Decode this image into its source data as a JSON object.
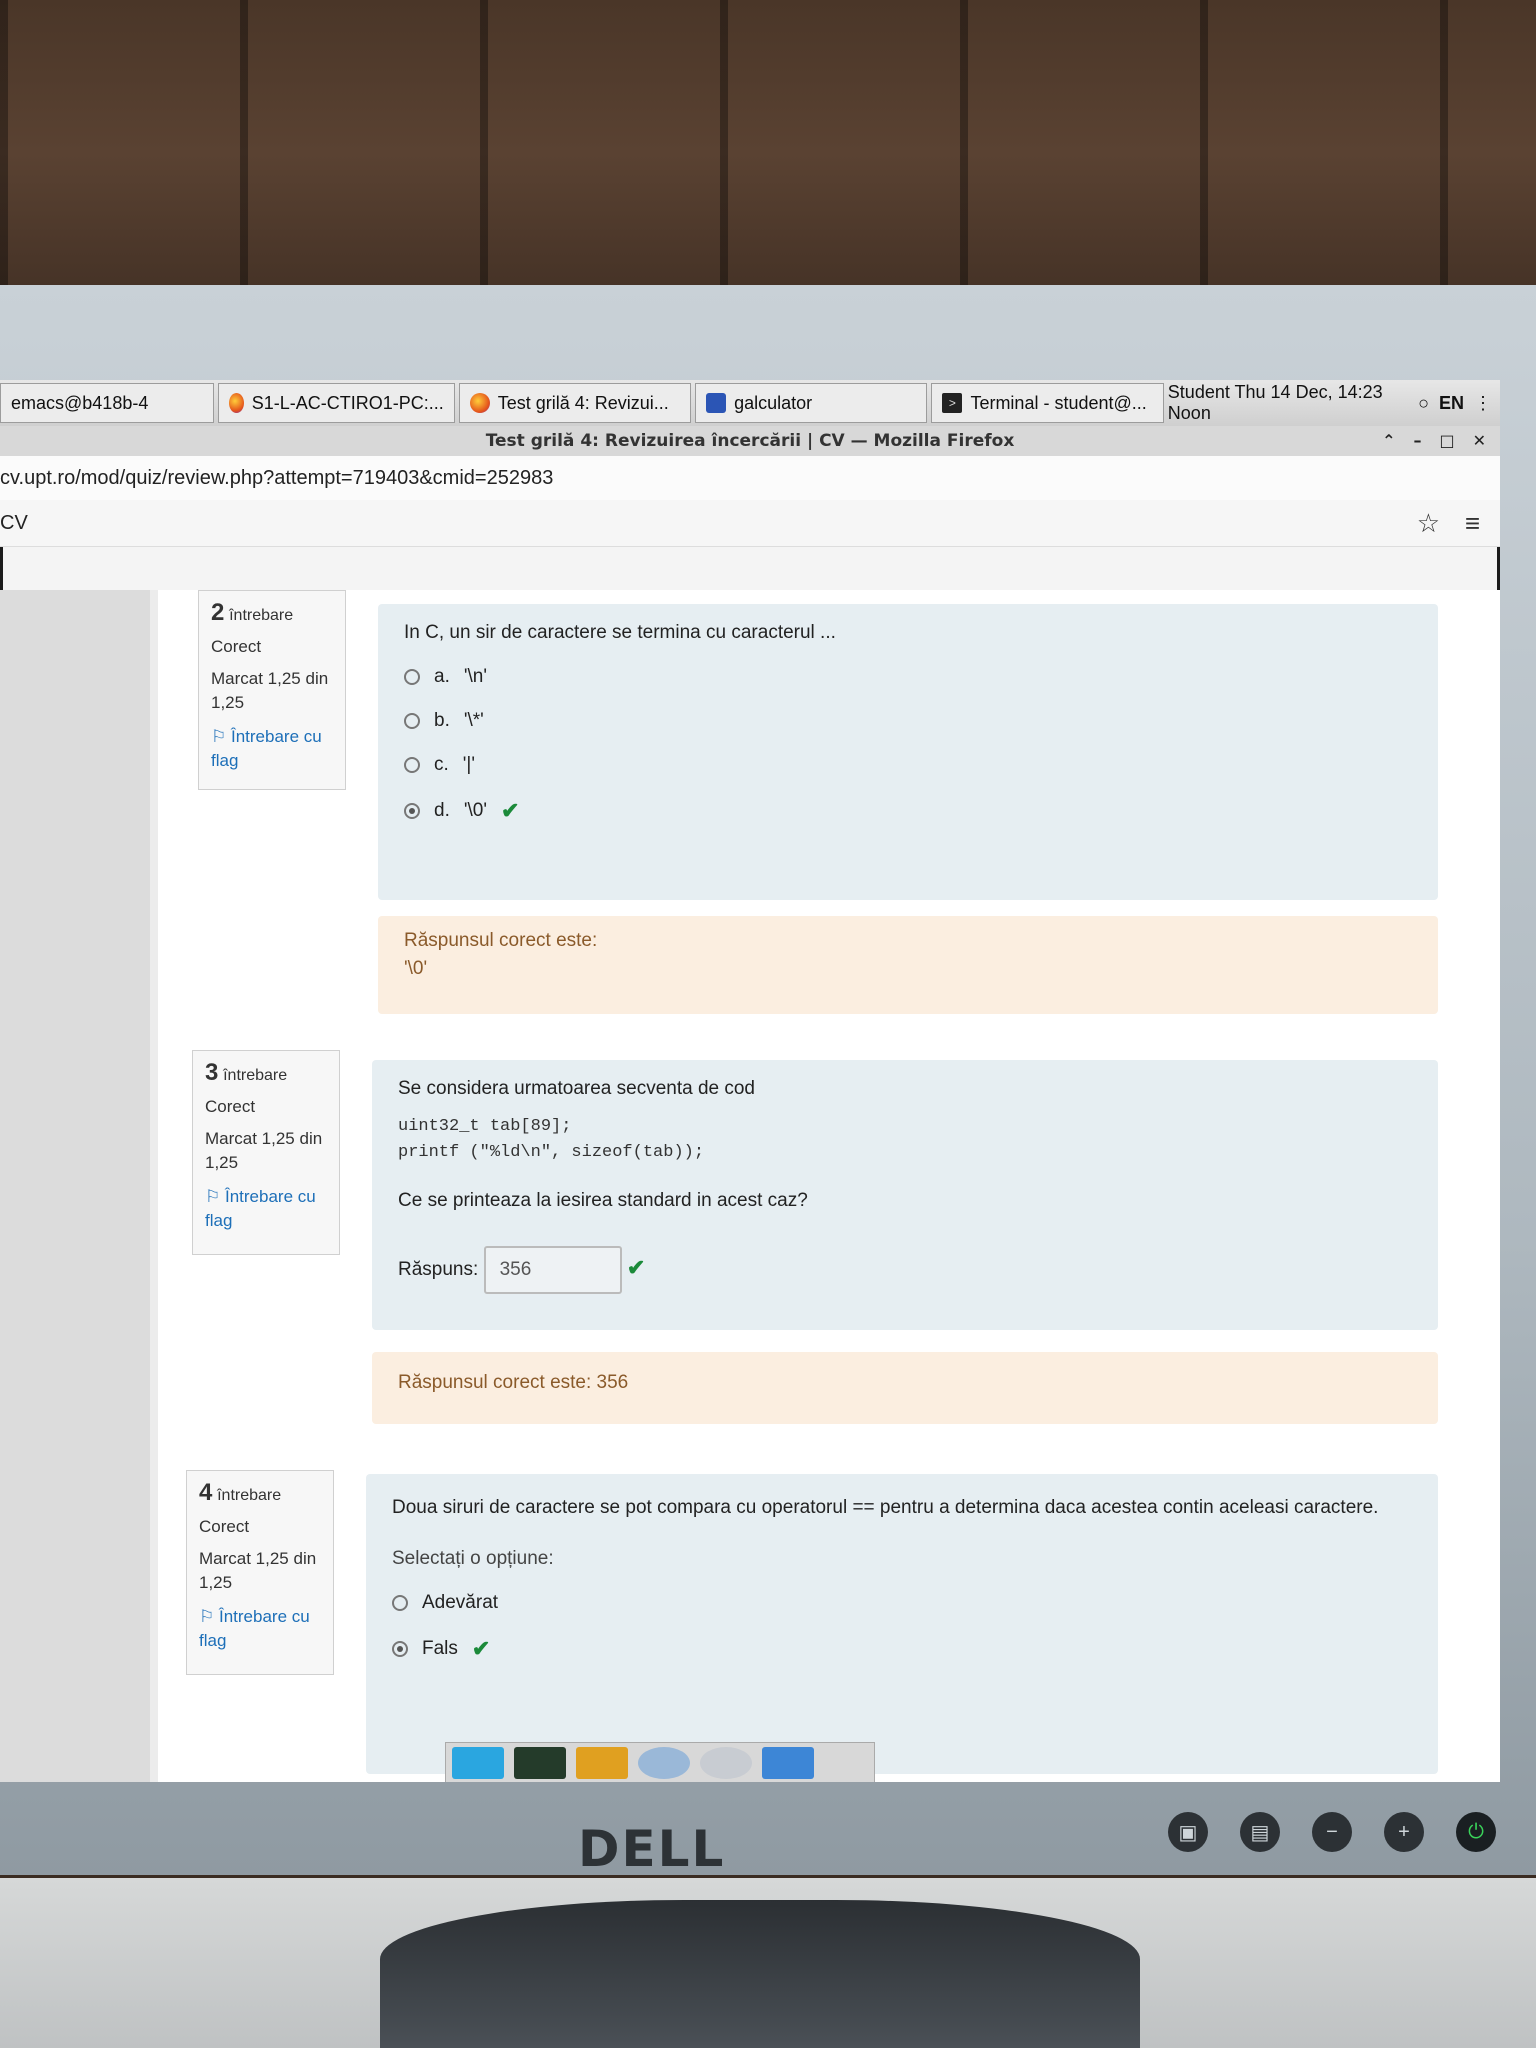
{
  "taskbar": {
    "tasks": [
      {
        "label": "emacs@b418b-4",
        "icon": "none"
      },
      {
        "label": "S1-L-AC-CTIRO1-PC:...",
        "icon": "firefox-icon"
      },
      {
        "label": "Test grilă 4: Revizui...",
        "icon": "firefox-icon"
      },
      {
        "label": "galculator",
        "icon": "calculator-icon"
      },
      {
        "label": "Terminal - student@...",
        "icon": "terminal-icon"
      }
    ],
    "clock": "Student Thu 14 Dec, 14:23 Noon",
    "lang": "EN"
  },
  "window": {
    "title": "Test grilă 4: Revizuirea încercării | CV — Mozilla Firefox",
    "url": "cv.upt.ro/mod/quiz/review.php?attempt=719403&cmid=252983",
    "site_label": "CV"
  },
  "questions": [
    {
      "number": "2",
      "word": "întrebare",
      "state": "Corect",
      "grade": "Marcat 1,25 din 1,25",
      "flag": "Întrebare cu flag",
      "text": "In C, un sir de caractere se termina cu caracterul ...",
      "options": [
        {
          "letter": "a.",
          "text": "'\\n'",
          "selected": false,
          "correct": false
        },
        {
          "letter": "b.",
          "text": "'\\*'",
          "selected": false,
          "correct": false
        },
        {
          "letter": "c.",
          "text": "'|'",
          "selected": false,
          "correct": false
        },
        {
          "letter": "d.",
          "text": "'\\0'",
          "selected": true,
          "correct": true
        }
      ],
      "feedback_title": "Răspunsul corect este:",
      "feedback_value": "'\\0'"
    },
    {
      "number": "3",
      "word": "întrebare",
      "state": "Corect",
      "grade": "Marcat 1,25 din 1,25",
      "flag": "Întrebare cu flag",
      "text": "Se considera urmatoarea secventa de cod",
      "code_line1": "uint32_t tab[89];",
      "code_line2": "printf (\"%ld\\n\", sizeof(tab));",
      "prompt": "Ce se printeaza la iesirea standard in acest caz?",
      "answer_label": "Răspuns:",
      "answer_value": "356",
      "feedback": "Răspunsul corect este: 356"
    },
    {
      "number": "4",
      "word": "întrebare",
      "state": "Corect",
      "grade": "Marcat 1,25 din 1,25",
      "flag": "Întrebare cu flag",
      "text": "Doua siruri de caractere se pot compara cu operatorul == pentru a determina daca acestea contin aceleasi caractere.",
      "select_label": "Selectați o opțiune:",
      "options": [
        {
          "text": "Adevărat",
          "selected": false
        },
        {
          "text": "Fals",
          "selected": true,
          "correct": true
        }
      ]
    }
  ],
  "monitor_brand": "DELL"
}
